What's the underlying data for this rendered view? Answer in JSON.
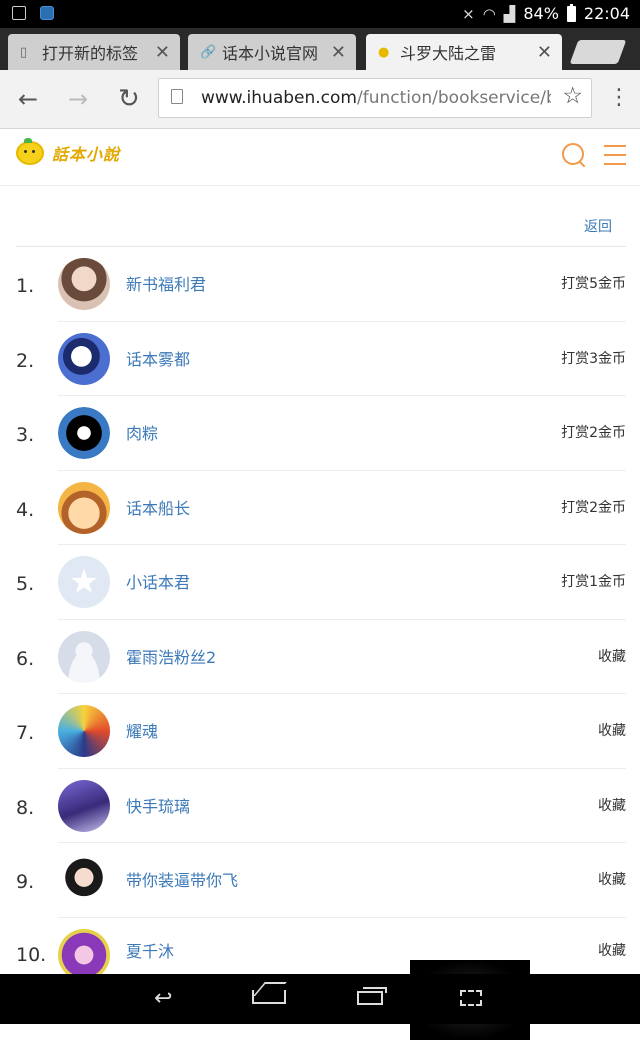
{
  "statusbar": {
    "battery": "84%",
    "time": "22:04"
  },
  "tabs": [
    {
      "title": "打开新的标签",
      "icon": "page-icon"
    },
    {
      "title": "话本小说官网",
      "icon": "link-icon"
    },
    {
      "title": "斗罗大陆之雷",
      "icon": "site-favicon",
      "active": true
    }
  ],
  "toolbar": {
    "url_host": "www.ihuaben.com",
    "url_path": "/function/bookservice/b"
  },
  "site": {
    "logo_text": "話本小說",
    "back_label": "返回"
  },
  "colors": {
    "link": "#3d7ab8",
    "accent": "#f39a4a",
    "logo": "#e2a800"
  },
  "ranking": [
    {
      "rank": "1.",
      "name": "新书福利君",
      "reward": "打赏5金币",
      "avatar": "photo-girl"
    },
    {
      "rank": "2.",
      "name": "话本雾都",
      "reward": "打赏3金币",
      "avatar": "anime-white"
    },
    {
      "rank": "3.",
      "name": "肉粽",
      "reward": "打赏2金币",
      "avatar": "black-emblem"
    },
    {
      "rank": "4.",
      "name": "话本船长",
      "reward": "打赏2金币",
      "avatar": "pirate-cartoon"
    },
    {
      "rank": "5.",
      "name": "小话本君",
      "reward": "打赏1金币",
      "avatar": "default-star"
    },
    {
      "rank": "6.",
      "name": "霍雨浩粉丝2",
      "reward": "收藏",
      "avatar": "default-person"
    },
    {
      "rank": "7.",
      "name": "耀魂",
      "reward": "收藏",
      "avatar": "colorful-art"
    },
    {
      "rank": "8.",
      "name": "快手琉璃",
      "reward": "收藏",
      "avatar": "purple-scene"
    },
    {
      "rank": "9.",
      "name": "带你装逼带你飞",
      "reward": "收藏",
      "avatar": "girl-portrait"
    },
    {
      "rank": "10.",
      "name": "夏千沐",
      "reward": "收藏",
      "avatar": "anime-purple"
    }
  ]
}
